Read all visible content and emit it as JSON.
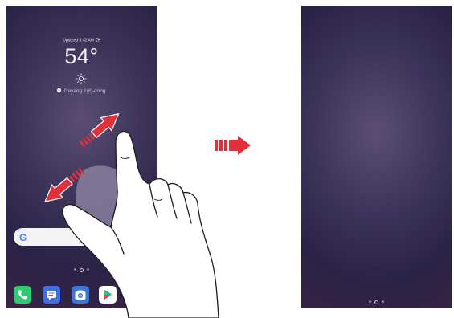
{
  "left_screen": {
    "weather": {
      "updated_text": "Updated 8:42 AM",
      "temperature": "54°",
      "location": "Gayang 1(il)-dong",
      "condition_icon": "sun-icon"
    },
    "search_icon_letter": "G",
    "dock_icons": [
      "phone-icon",
      "messages-icon",
      "camera-icon",
      "play-store-icon"
    ],
    "page_dots": 3
  },
  "right_screen": {
    "page_dots": 3
  },
  "gesture": {
    "type": "pinch-out",
    "icons": [
      "expand-arrow-up-icon",
      "expand-arrow-down-icon",
      "hand-icon"
    ]
  },
  "transition_arrow_icon": "next-step-arrow-icon",
  "colors": {
    "arrow_red": "#e0313a",
    "phone_green": "#2ecc71",
    "messages_blue": "#3e6fe0",
    "camera_blue": "#3a78d8"
  }
}
